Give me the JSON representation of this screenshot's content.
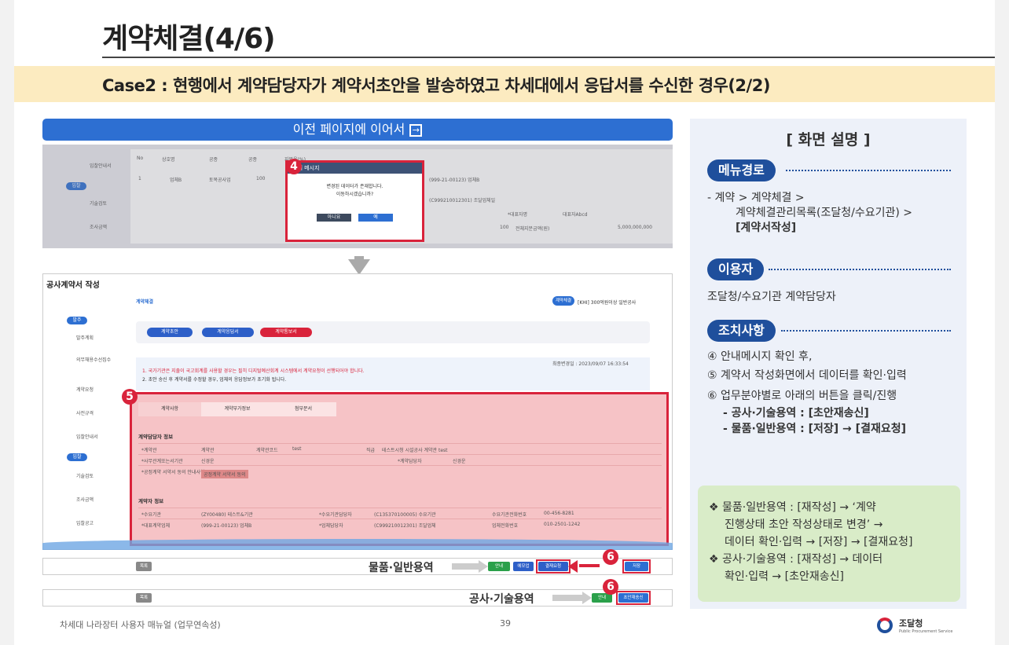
{
  "header": {
    "title": "계약체결(4/6)",
    "case": "Case2 : 현행에서 계약담당자가 계약서초안을 발송하였고 차세대에서 응답서를 수신한 경우(2/2)"
  },
  "continue_bar": {
    "label": "이전 페이지에 이어서"
  },
  "shot1": {
    "sidebar": [
      "입찰안내서",
      "입찰",
      "기술검토",
      "조사금액"
    ],
    "table_headers": [
      "No",
      "상호명",
      "공종",
      "공종",
      "지분율(%)"
    ],
    "table_row": [
      "1",
      "업체B",
      "토목공사업",
      "100"
    ],
    "right_fields": [
      "(999-21-00123) 업체B",
      "(C999210012301) 조달업체일",
      "*대표자명",
      "대표자Abcd",
      "100",
      "전체지분금액(원)",
      "5,000,000,000"
    ],
    "dialog": {
      "badge": "4",
      "header": "안내 메시지",
      "message1": "변경된 데이터가 존재합니다.",
      "message2": "이동하시겠습니까?",
      "no": "아니요",
      "yes": "예"
    }
  },
  "shot2": {
    "title": "공사계약서 작성",
    "subtitle": "계약체결",
    "right_tag": "계약체결",
    "right_text": "[KHI] 300억원이상 일반공사",
    "sidebar": [
      {
        "label": "발주",
        "pill": true
      },
      {
        "label": "발주계획"
      },
      {
        "label": "의무채용수선집수"
      },
      {
        "label": "계약요청"
      },
      {
        "label": "사전규격"
      },
      {
        "label": "입찰안내서"
      },
      {
        "label": "입찰",
        "pill": true
      },
      {
        "label": "기술검토"
      },
      {
        "label": "조사금액"
      },
      {
        "label": "입찰공고"
      }
    ],
    "steps": [
      "계약초안",
      "계약응답서",
      "계약통보서"
    ],
    "notice_line1": "1. 국가기관은 지출이 국고회계를 사용할 경우는 필히 디지털예산회계 시스템에서 계약요청이 선행되어야 합니다.",
    "notice_line2": "2. 초안 송신 후 계약서를 수정할 경우, 업체의 응답정보가 초기화 됩니다.",
    "last_changed": "최종변경일 : 2023/09/07 16:33:54",
    "form_badge": "5",
    "tabs": [
      "계약사항",
      "계약부가정보",
      "첨부문서"
    ],
    "section1": "계약담당자 정보",
    "rows1": [
      [
        "*계약관",
        "계약관",
        "계약관코드",
        "test",
        "직급",
        "테스트시청 시설공사 계약관 test"
      ],
      [
        "*사무관계또는서기관",
        "신경운",
        "*계약담당자",
        "신경운"
      ],
      [
        "*공정계약 서약서 동의 안내사항",
        "공정계약 서약서 동의"
      ]
    ],
    "section2": "계약자 정보",
    "rows2": [
      [
        "*수요기관",
        "(ZY00480) 테스트&기관",
        "*수요기관담당자",
        "(C135370100005) 수요기관",
        "수요기관전화번호",
        "00-456-8281"
      ],
      [
        "*대표계약업체",
        "(999-21-00123) 업체B",
        "*업체담당자",
        "(C999210012301) 조달업체",
        "업체전화번호",
        "010-2501-1242"
      ]
    ]
  },
  "bottom_bars": [
    {
      "label": "물품·일반용역",
      "left_btn": "목록",
      "buttons": [
        "안내",
        "에모업",
        "결재요청",
        "저장"
      ],
      "badge": "6"
    },
    {
      "label": "공사·기술용역",
      "left_btn": "목록",
      "buttons": [
        "안내",
        "초안재송신"
      ],
      "badge": "6"
    }
  ],
  "description": {
    "title": "[ 화면 설명 ]",
    "menu_path_tag": "메뉴경로",
    "menu_path": [
      "-  계약 > 계약체결 >",
      "계약체결관리목록(조달청/수요기관) >",
      "[계약서작성]"
    ],
    "user_tag": "이용자",
    "user": "조달청/수요기관 계약담당자",
    "action_tag": "조치사항",
    "actions": [
      "④ 안내메시지 확인 후,",
      "⑤ 계약서 작성화면에서 데이터를 확인·입력",
      "⑥ 업무분야별로 아래의 버튼을 클릭/진행",
      "- 공사·기술용역 : [초안재송신]",
      "- 물품·일반용역 : [저장] → [결재요청]"
    ],
    "notes": [
      "❖ 물품·일반용역 : [재작성] → ‘계약",
      "진행상태 초안 작성상태로 변경’ →",
      "데이터 확인·입력 → [저장] → [결재요청]",
      "❖ 공사·기술용역 : [재작성] → 데이터",
      "확인·입력 → [초안재송신]"
    ]
  },
  "footer": {
    "left": "차세대 나라장터 사용자 매뉴얼 (업무연속성)",
    "page": "39",
    "logo_text": "조달청",
    "logo_sub": "Public Procurement Service"
  }
}
